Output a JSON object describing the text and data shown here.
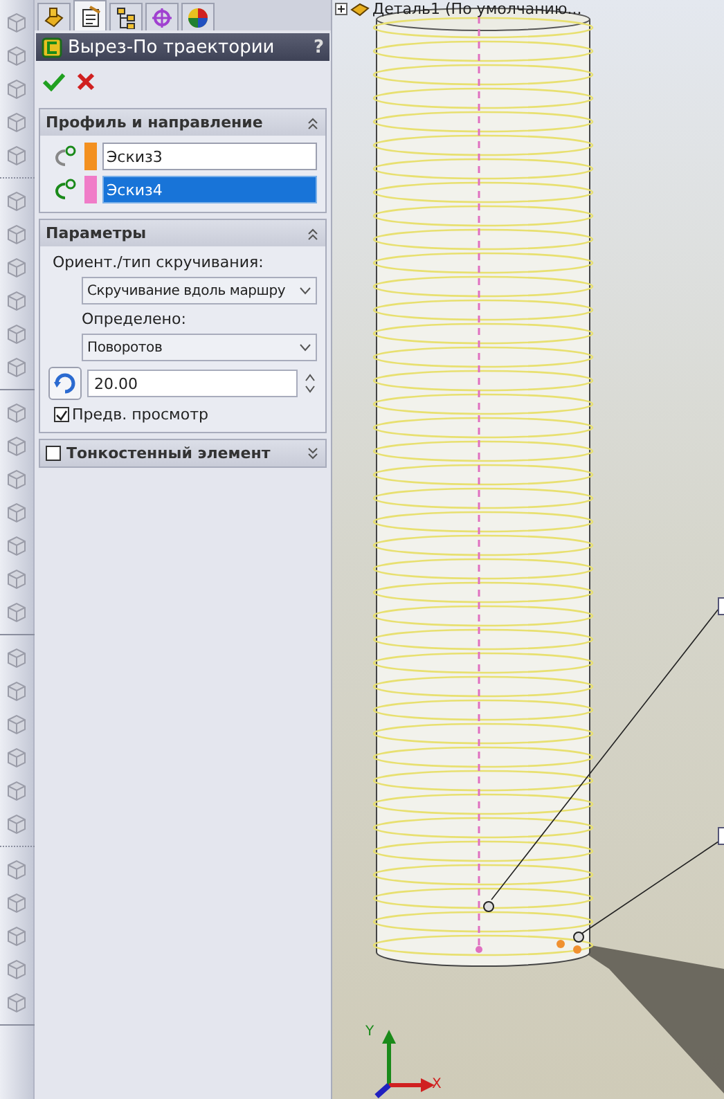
{
  "tabs": [
    {
      "kind": "feature",
      "selected": false
    },
    {
      "kind": "property",
      "selected": true
    },
    {
      "kind": "config",
      "selected": false
    },
    {
      "kind": "dimxpert",
      "selected": false
    },
    {
      "kind": "display",
      "selected": false
    }
  ],
  "property_manager": {
    "title": "Вырез-По траектории",
    "help": "?"
  },
  "profile_section": {
    "title": "Профиль и направление",
    "expanded": true,
    "fields": [
      {
        "kind": "profile",
        "value": "Эскиз3",
        "color": "#f39020",
        "selected": false
      },
      {
        "kind": "path",
        "value": "Эскиз4",
        "color": "#f07cc8",
        "selected": true
      }
    ]
  },
  "parameters_section": {
    "title": "Параметры",
    "expanded": true,
    "orientation_label": "Ориент./тип скручивания:",
    "orientation_value": "Скручивание вдоль маршру",
    "defined_label": "Определено:",
    "defined_value": "Поворотов",
    "turns_value": "20.00",
    "preview": {
      "label": "Предв. просмотр",
      "checked": true
    }
  },
  "thin_feature_section": {
    "title": "Тонкостенный элемент",
    "checked": false,
    "expanded": false
  },
  "viewport": {
    "tree_node": "Деталь1 (По умолчанию...",
    "axis_y": "Y",
    "axis_x": "X"
  }
}
